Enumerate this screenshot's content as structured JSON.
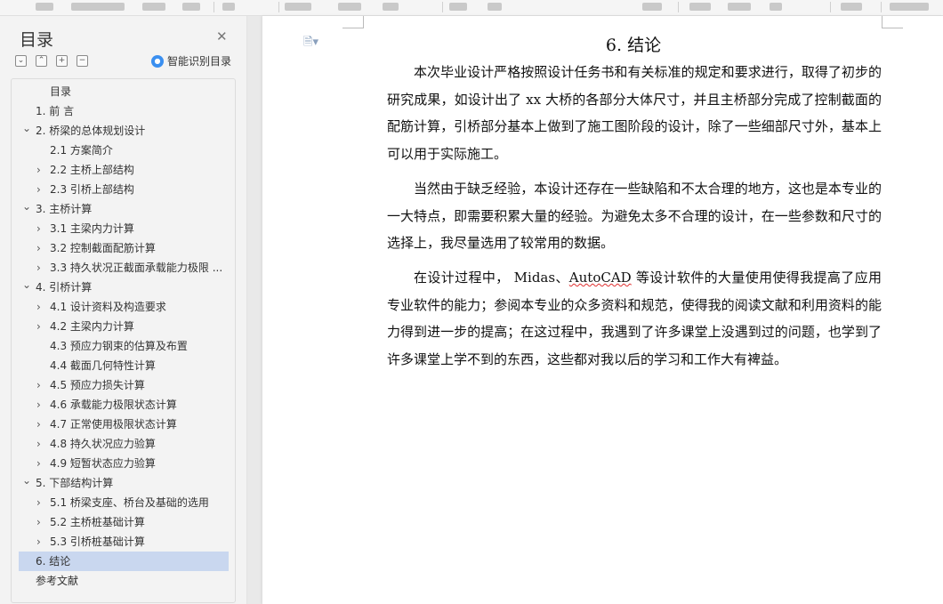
{
  "sidebar": {
    "title": "目录",
    "smart_toc_label": "智能识别目录",
    "items": [
      {
        "label": "目录",
        "level": 1,
        "chevron": "none"
      },
      {
        "label": "1.   前 言",
        "level": 0,
        "chevron": "none"
      },
      {
        "label": "2.   桥梁的总体规划设计",
        "level": 0,
        "chevron": "down"
      },
      {
        "label": "2.1  方案简介",
        "level": 1,
        "chevron": "none"
      },
      {
        "label": "2.2  主桥上部结构",
        "level": 1,
        "chevron": "right"
      },
      {
        "label": "2.3  引桥上部结构",
        "level": 1,
        "chevron": "right"
      },
      {
        "label": "3.   主桥计算",
        "level": 0,
        "chevron": "down"
      },
      {
        "label": "3.1  主梁内力计算",
        "level": 1,
        "chevron": "right"
      },
      {
        "label": "3.2  控制截面配筋计算",
        "level": 1,
        "chevron": "right"
      },
      {
        "label": "3.3  持久状况正截面承载能力极限 ...",
        "level": 1,
        "chevron": "right"
      },
      {
        "label": "4.   引桥计算",
        "level": 0,
        "chevron": "down"
      },
      {
        "label": "4.1  设计资料及构造要求",
        "level": 1,
        "chevron": "right"
      },
      {
        "label": "4.2  主梁内力计算",
        "level": 1,
        "chevron": "right"
      },
      {
        "label": "4.3  预应力钢束的估算及布置",
        "level": 1,
        "chevron": "none"
      },
      {
        "label": "4.4  截面几何特性计算",
        "level": 1,
        "chevron": "none"
      },
      {
        "label": "4.5  预应力损失计算",
        "level": 1,
        "chevron": "right"
      },
      {
        "label": "4.6  承载能力极限状态计算",
        "level": 1,
        "chevron": "right"
      },
      {
        "label": "4.7  正常使用极限状态计算",
        "level": 1,
        "chevron": "right"
      },
      {
        "label": "4.8  持久状况应力验算",
        "level": 1,
        "chevron": "right"
      },
      {
        "label": "4.9  短暂状态应力验算",
        "level": 1,
        "chevron": "right"
      },
      {
        "label": "5.   下部结构计算",
        "level": 0,
        "chevron": "down"
      },
      {
        "label": "5.1  桥梁支座、桥台及基础的选用",
        "level": 1,
        "chevron": "right"
      },
      {
        "label": "5.2  主桥桩基础计算",
        "level": 1,
        "chevron": "right"
      },
      {
        "label": "5.3  引桥桩基础计算",
        "level": 1,
        "chevron": "right"
      },
      {
        "label": "6.   结论",
        "level": 0,
        "chevron": "none",
        "active": true
      },
      {
        "label": "参考文献",
        "level": 0,
        "chevron": "none"
      }
    ]
  },
  "document": {
    "heading": "6.    结论",
    "paragraphs": [
      "本次毕业设计严格按照设计任务书和有关标准的规定和要求进行，取得了初步的研究成果，如设计出了 xx 大桥的各部分大体尺寸，并且主桥部分完成了控制截面的配筋计算，引桥部分基本上做到了施工图阶段的设计，除了一些细部尺寸外，基本上可以用于实际施工。",
      "当然由于缺乏经验，本设计还存在一些缺陷和不太合理的地方，这也是本专业的一大特点，即需要积累大量的经验。为避免太多不合理的设计，在一些参数和尺寸的选择上，我尽量选用了较常用的数据。"
    ],
    "p3_before": "在设计过程中，  Midas、",
    "p3_squiggle": "AutoCAD",
    "p3_after": " 等设计软件的大量使用使得我提高了应用专业软件的能力；参阅本专业的众多资料和规范，使得我的阅读文献和利用资料的能力得到进一步的提高；在这过程中，我遇到了许多课堂上没遇到过的问题，也学到了许多课堂上学不到的东西，这些都对我以后的学习和工作大有裨益。"
  }
}
